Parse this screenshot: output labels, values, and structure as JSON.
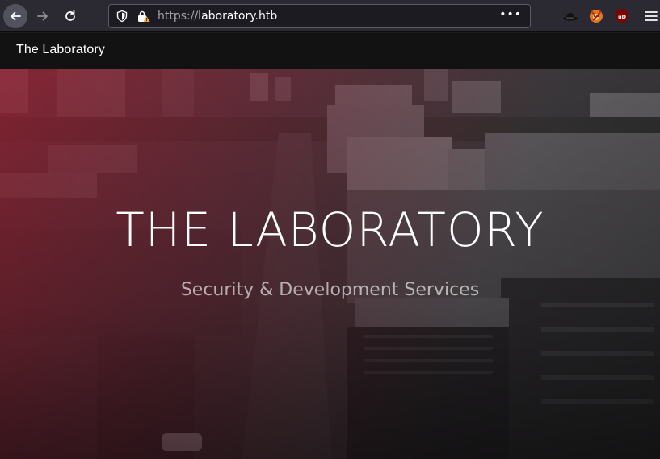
{
  "browser": {
    "url_protocol": "https://",
    "url_host": "laboratory.htb",
    "page_actions": "•••",
    "icons": {
      "back": "arrow-left-icon",
      "forward": "arrow-right-icon",
      "reload": "reload-icon",
      "tracking": "shield-icon",
      "security": "insecure-lock-icon",
      "extension_1": "hat-icon",
      "extension_2": "fox-icon",
      "extension_3": "ublock-icon",
      "menu": "hamburger-menu-icon"
    },
    "ublock_text": "uD"
  },
  "site": {
    "brand": "The Laboratory",
    "hero_title": "THE LABORATORY",
    "hero_subtitle": "Security & Development Services"
  },
  "colors": {
    "toolbar_bg": "#2b2a33",
    "urlbar_bg": "#1c1b22",
    "navbar_bg": "#121212",
    "hero_tint": "#a01e32",
    "warning": "#ffa436"
  }
}
